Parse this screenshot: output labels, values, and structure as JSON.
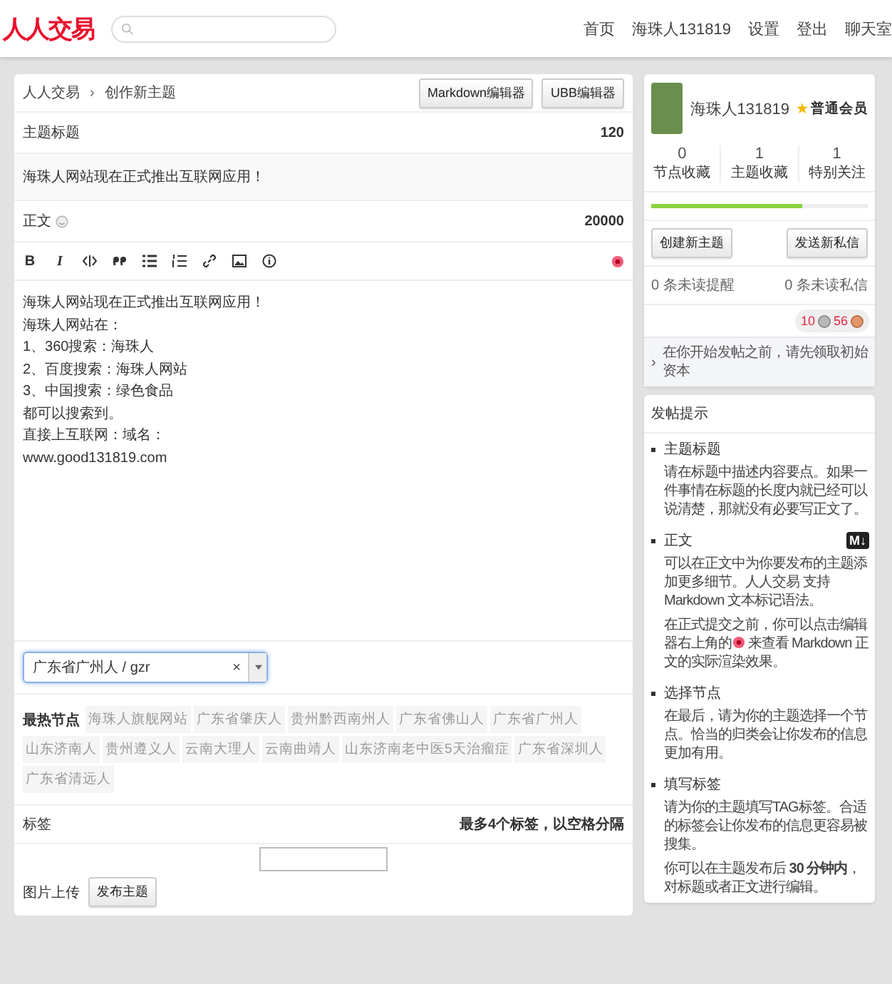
{
  "header": {
    "logo": "人人交易",
    "nav": [
      {
        "label": "首页"
      },
      {
        "label": "海珠人131819"
      },
      {
        "label": "设置"
      },
      {
        "label": "登出"
      },
      {
        "label": "聊天室"
      }
    ]
  },
  "breadcrumb": {
    "items": [
      "人人交易",
      "创作新主题"
    ],
    "separator": "›"
  },
  "editor_buttons": [
    "Markdown编辑器",
    "UBB编辑器"
  ],
  "title_field": {
    "label": "主题标题",
    "count": "120",
    "value": "海珠人网站现在正式推出互联网应用！"
  },
  "body_field": {
    "label": "正文",
    "count": "20000",
    "lines": [
      "海珠人网站现在正式推出互联网应用！",
      "海珠人网站在：",
      "1、360搜索：海珠人",
      "2、百度搜索：海珠人网站",
      "3、中国搜索：绿色食品",
      "都可以搜索到。",
      "直接上互联网：域名：",
      "www.good131819.com"
    ]
  },
  "toolbar": [
    {
      "kind": "bold",
      "label": "B"
    },
    {
      "kind": "italic",
      "label": "I"
    },
    {
      "kind": "code"
    },
    {
      "kind": "quote"
    },
    {
      "kind": "ul"
    },
    {
      "kind": "ol"
    },
    {
      "kind": "link"
    },
    {
      "kind": "image"
    },
    {
      "kind": "info"
    },
    {
      "kind": "preview"
    }
  ],
  "node_select": {
    "value": "广东省广州人 / gzr",
    "clear": "×"
  },
  "hot_nodes": {
    "label": "最热节点",
    "items": [
      "海珠人旗舰网站",
      "广东省肇庆人",
      "贵州黔西南州人",
      "广东省佛山人",
      "广东省广州人",
      "山东济南人",
      "贵州遵义人",
      "云南大理人",
      "云南曲靖人",
      "山东济南老中医5天治瘤症",
      "广东省深圳人",
      "广东省清远人"
    ]
  },
  "tags": {
    "label": "标签",
    "hint": "最多4个标签，以空格分隔"
  },
  "upload_label": "图片上传",
  "submit": "发布主题",
  "user": {
    "name": "海珠人131819",
    "rank": "普通会员",
    "stats": [
      {
        "value": "0",
        "label": "节点收藏"
      },
      {
        "value": "1",
        "label": "主题收藏"
      },
      {
        "value": "1",
        "label": "特别关注"
      }
    ],
    "progress": {
      "level": 0.7
    },
    "buttons": [
      "创建新主题",
      "发送新私信"
    ],
    "unread": [
      "0 条未读提醒",
      "0 条未读私信"
    ],
    "balance": [
      {
        "amount": "10",
        "kind": "silver"
      },
      {
        "amount": "56",
        "kind": "bronze"
      }
    ],
    "notice_marker": "›",
    "notice": "在你开始发帖之前，请先领取初始资本"
  },
  "tips": {
    "title": "发帖提示",
    "sections": [
      {
        "title": "主题标题",
        "paragraphs": [
          {
            "kind": "text",
            "text": "请在标题中描述内容要点。如果一件事情在标题的长度内就已经可以说清楚，那就没有必要写正文了。"
          }
        ]
      },
      {
        "title": "正文",
        "badge": "M↓",
        "paragraphs": [
          {
            "kind": "text",
            "text": "可以在正文中为你要发布的主题添加更多细节。人人交易 支持 Markdown 文本标记语法。"
          },
          {
            "kind": "icon",
            "before": "在正式提交之前，你可以点击编辑器右上角的",
            "after": "来查看 Markdown 正文的实际渲染效果。"
          }
        ]
      },
      {
        "title": "选择节点",
        "paragraphs": [
          {
            "kind": "text",
            "text": "在最后，请为你的主题选择一个节点。恰当的归类会让你发布的信息更加有用。"
          }
        ]
      },
      {
        "title": "填写标签",
        "paragraphs": [
          {
            "kind": "text",
            "text": "请为你的主题填写TAG标签。合适的标签会让你发布的信息更容易被搜集。"
          },
          {
            "kind": "text",
            "text": "你可以在主题发布后 **30 分钟内**，对标题或者正文进行编辑。"
          }
        ]
      }
    ]
  }
}
